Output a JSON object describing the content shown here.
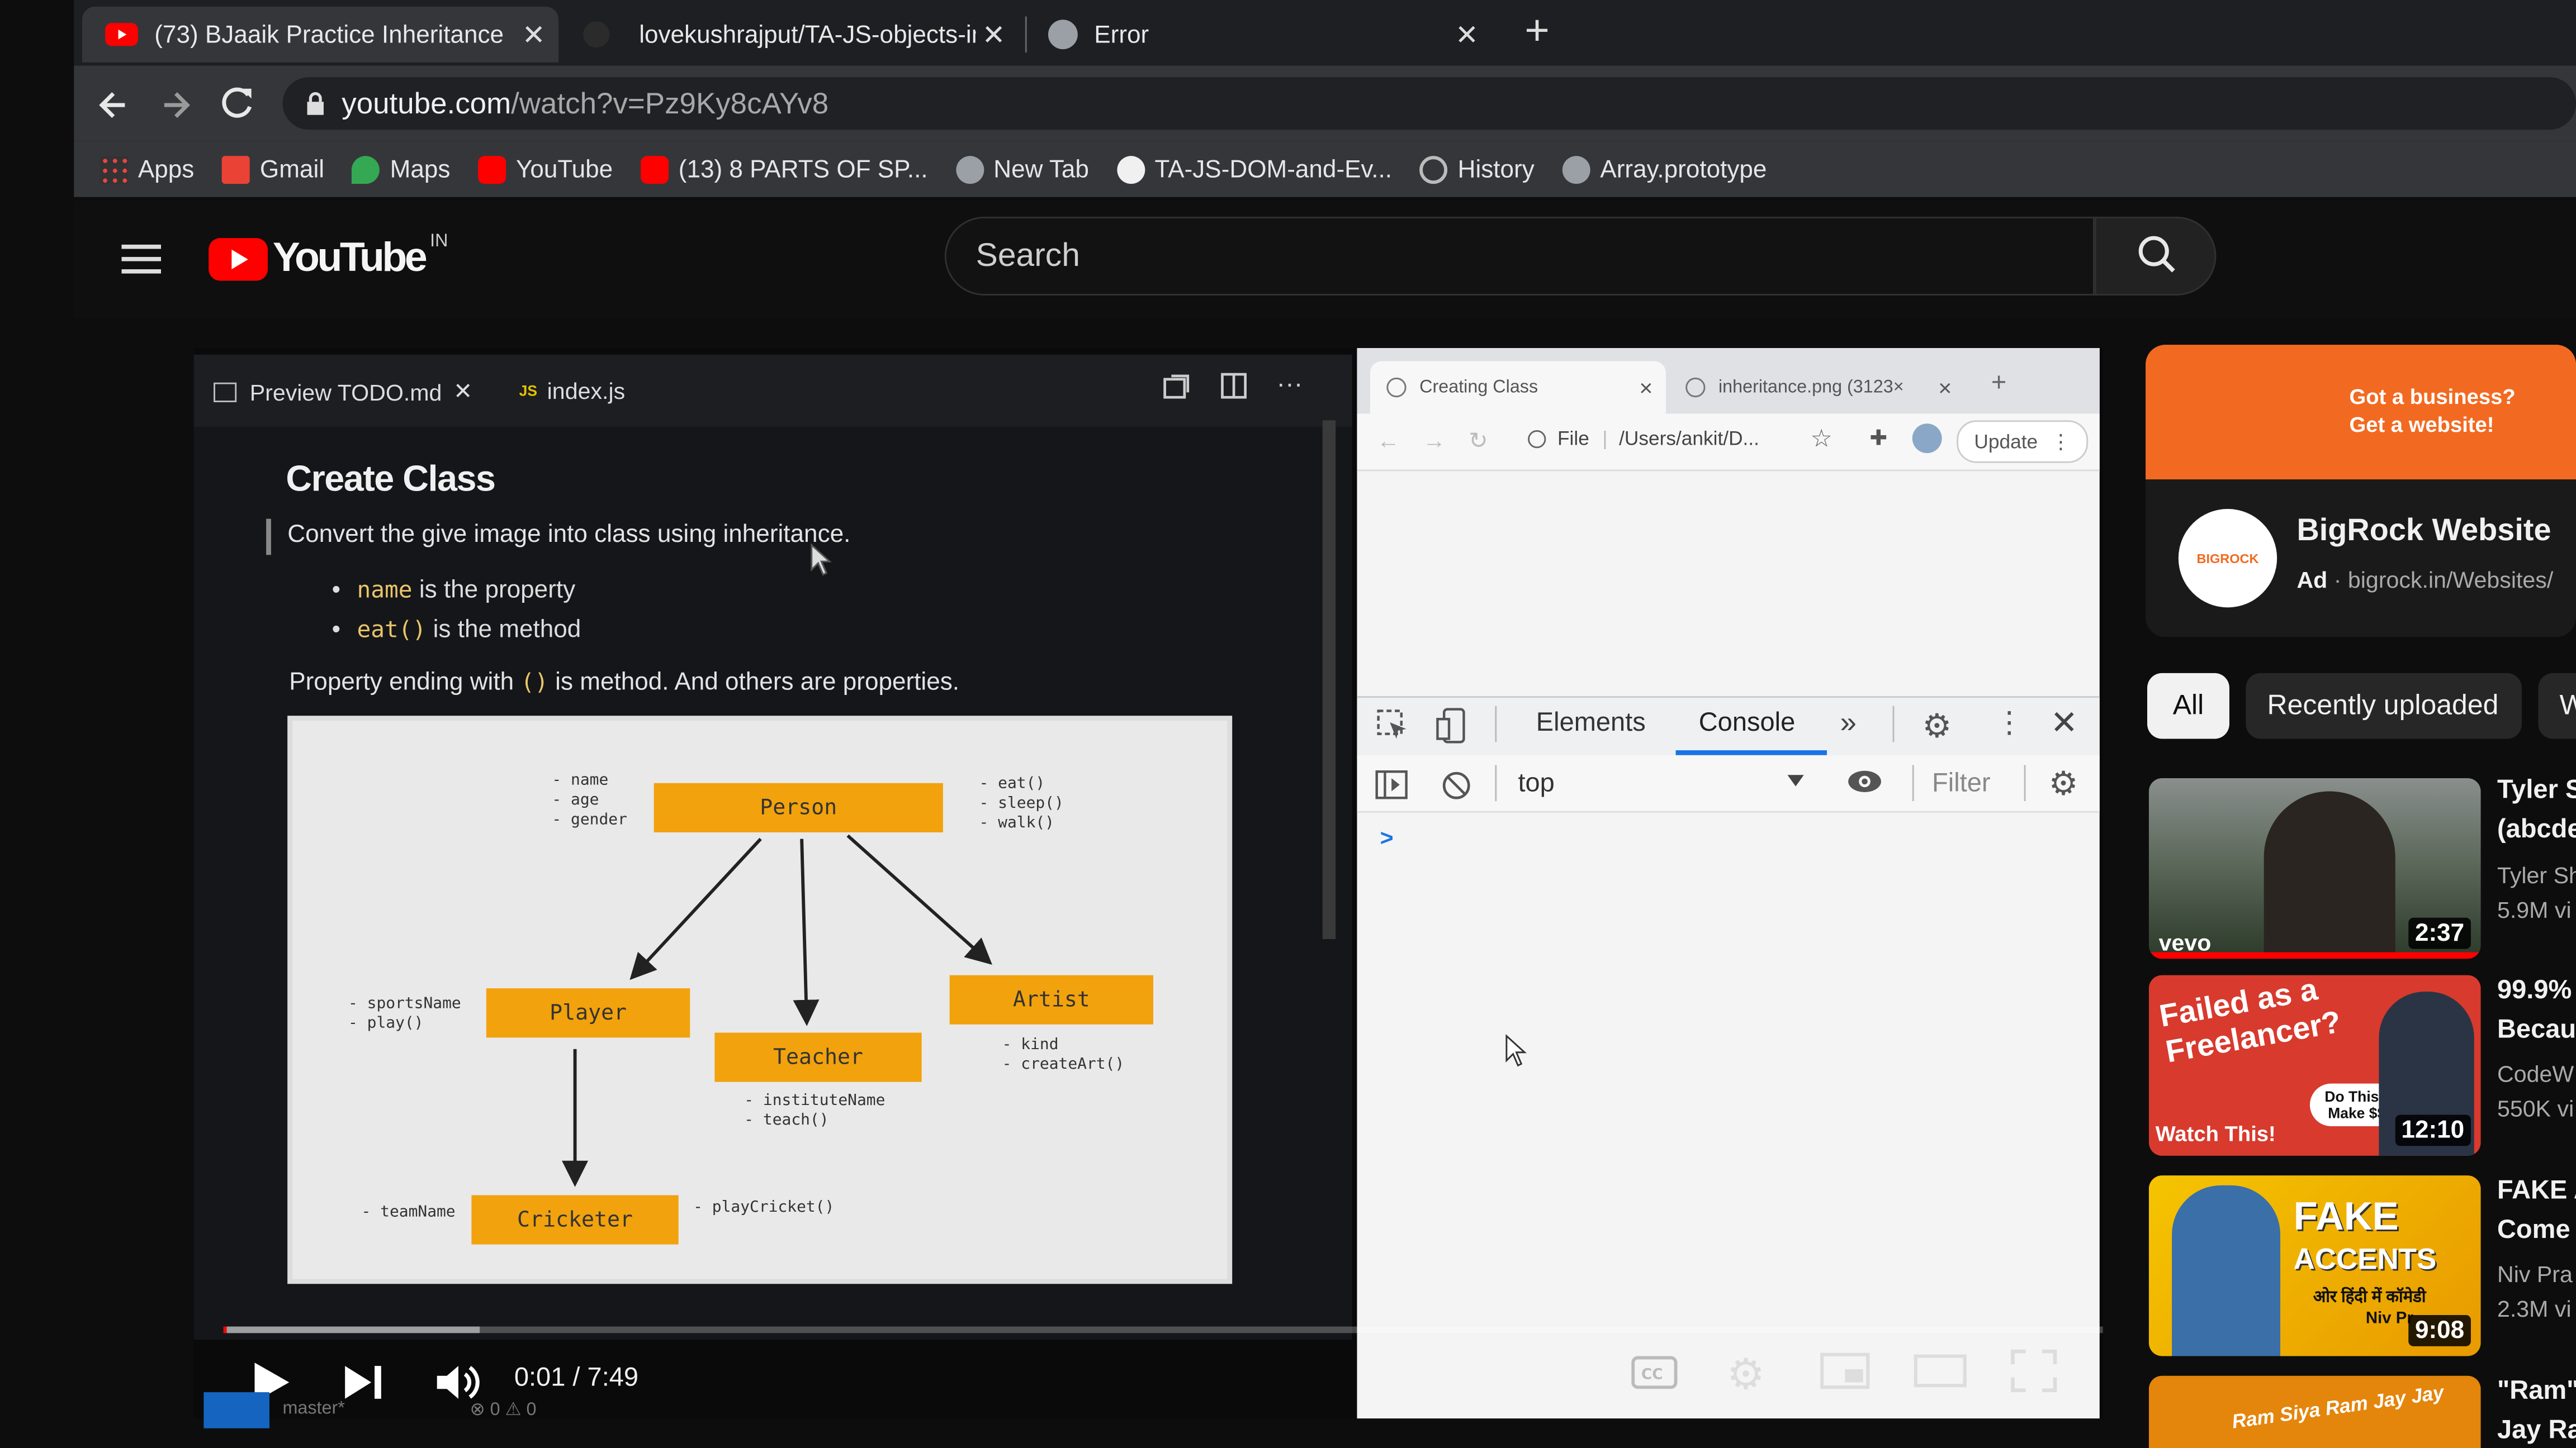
{
  "browser": {
    "tabs": [
      {
        "title": "(73) BJaaik Practice Inheritance -",
        "close": "✕"
      },
      {
        "title": "lovekushrajput/TA-JS-objects-in-",
        "close": "✕"
      },
      {
        "title": "Error",
        "close": "✕"
      }
    ],
    "new_tab": "+",
    "address": {
      "host": "youtube.com",
      "path": "/watch?v=Pz9Ky8cAYv8"
    },
    "bookmarks": [
      "Apps",
      "Gmail",
      "Maps",
      "YouTube",
      "(13) 8 PARTS OF SP...",
      "New Tab",
      "TA-JS-DOM-and-Ev...",
      "History",
      "Array.prototype"
    ]
  },
  "youtube": {
    "logo": "YouTube",
    "region": "IN",
    "search_placeholder": "Search"
  },
  "editor": {
    "tabs": [
      {
        "icon": "preview",
        "label": "Preview TODO.md",
        "close": "✕"
      },
      {
        "icon": "JS",
        "label": "index.js"
      }
    ],
    "heading": "Create Class",
    "quote": "Convert the give image into class using inheritance.",
    "bullets": [
      {
        "code": "name",
        "text": " is the property"
      },
      {
        "code": "eat()",
        "text": " is the method"
      }
    ],
    "para_before": "Property ending with ",
    "para_code": "()",
    "para_after": " is method. And others are properties."
  },
  "diagram": {
    "nodes": {
      "person": "Person",
      "player": "Player",
      "teacher": "Teacher",
      "artist": "Artist",
      "cricketer": "Cricketer"
    },
    "notes": {
      "person_props": "- name\n- age\n- gender",
      "person_methods": "- eat()\n- sleep()\n- walk()",
      "player": "- sportsName\n- play()",
      "teacher": "- instituteName\n- teach()",
      "artist": "- kind\n- createArt()",
      "cricketer_left": "- teamName",
      "cricketer_right": "- playCricket()"
    }
  },
  "chrome_window": {
    "tabs": [
      {
        "title": "Creating Class",
        "close": "×"
      },
      {
        "title": "inheritance.png (3123×",
        "close": "×"
      }
    ],
    "new_tab": "+",
    "file_label": "File",
    "path": "/Users/ankit/D...",
    "update": "Update",
    "devtools_tabs": [
      "Elements",
      "Console",
      "»"
    ],
    "active_devtools_tab": "Console",
    "context": "top",
    "filter_placeholder": "Filter",
    "prompt": ">"
  },
  "player": {
    "time": "0:01 / 7:49",
    "progress": 0.002,
    "status_branch": "master*",
    "status_counts": "⊗ 0 ⚠ 0"
  },
  "sidebar": {
    "ad": {
      "banner_line1": "Got a business?",
      "banner_line2": "Get a website!",
      "logo_text": "BIGROCK",
      "title": "BigRock Website",
      "badge": "Ad",
      "url": "bigrock.in/Websites/"
    },
    "chips": [
      "All",
      "Recently uploaded",
      "W"
    ],
    "videos": [
      {
        "duration": "2:37",
        "badge": "vevo",
        "title1": "Tyler S",
        "title2": "(abcde",
        "channel": "Tyler Sh",
        "views": "5.9M vi"
      },
      {
        "duration": "12:10",
        "thumb_line1": "Failed as a",
        "thumb_line2": "Freelancer?",
        "thumb_cta": "Watch This!",
        "thumb_note": "Do This to Make $$$",
        "title1": "99.9%",
        "title2": "Becau",
        "channel": "CodeW",
        "views": "550K vi"
      },
      {
        "duration": "9:08",
        "thumb_line1": "FAKE",
        "thumb_line2": "ACCENTS",
        "thumb_sub": "ओर हिंदी में कॉमेडी",
        "thumb_name": "Niv Pr",
        "title1": "FAKE A",
        "title2": "Come",
        "channel": "Niv Pra",
        "views": "2.3M vi"
      },
      {
        "thumb_text": "Ram Siya Ram Jay Jay",
        "title1": "\"Ram\"",
        "title2": "Jay Ra"
      }
    ]
  }
}
